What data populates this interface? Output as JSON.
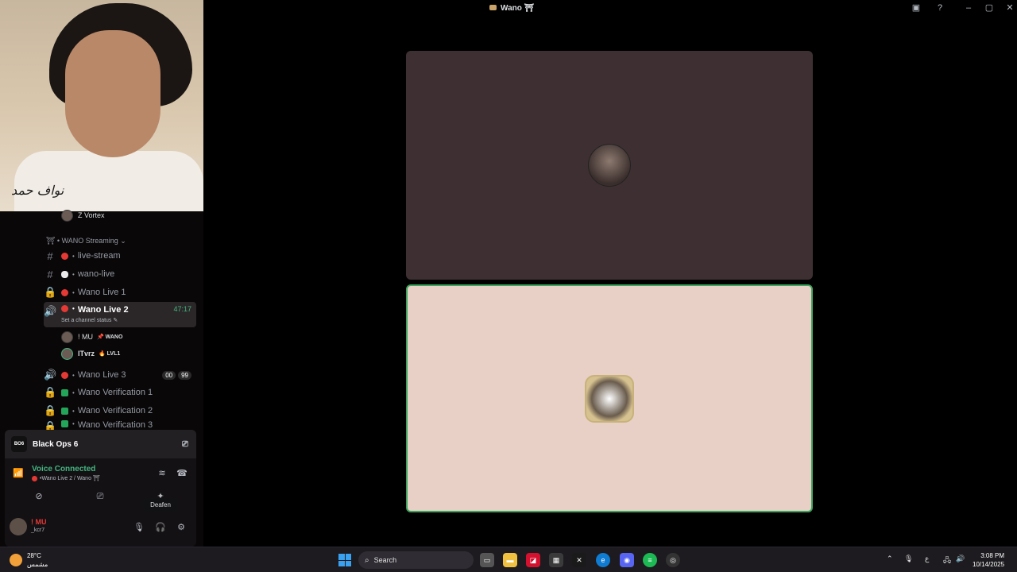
{
  "window": {
    "title": "Wano ⛩",
    "icons": {
      "inbox": "inbox-icon",
      "help": "help-icon",
      "minimize": "minimize-icon",
      "maximize": "maximize-icon",
      "close": "close-icon"
    }
  },
  "overlay": {
    "signature": "نواف حمد"
  },
  "sidebar": {
    "partial_member": "Z Vortex",
    "category": "WANO Streaming",
    "channels": [
      {
        "label": "live-stream",
        "type": "text"
      },
      {
        "label": "wano-live",
        "type": "text"
      },
      {
        "label": "Wano Live 1",
        "type": "locked-voice"
      },
      {
        "label": "Wano Live 2",
        "type": "voice-active",
        "timer": "47:17",
        "status_placeholder": "Set a channel status"
      },
      {
        "label": "Wano Live 3",
        "type": "voice",
        "count_a": "00",
        "count_b": "99"
      },
      {
        "label": "Wano Verification 1",
        "type": "locked-voice"
      },
      {
        "label": "Wano Verification 2",
        "type": "locked-voice"
      },
      {
        "label": "Wano Verification 3",
        "type": "locked-voice"
      }
    ],
    "members": [
      {
        "name": "! MU",
        "tag": "📌 WANO"
      },
      {
        "name": "lTvrz",
        "tag": "🔥 LVL1"
      }
    ]
  },
  "panel": {
    "game": "Black Ops 6",
    "game_logo": "BO6",
    "voice_status": "Voice Connected",
    "voice_channel": "Wano Live 2 / Wano ⛩",
    "tooltip": "Deafen",
    "username": "! MU",
    "usertag": "_kcr7"
  },
  "tiles": [
    {
      "avatar": "user-avatar-1"
    },
    {
      "avatar": "user-avatar-2",
      "speaking": true
    }
  ],
  "taskbar": {
    "weather_temp": "28°C",
    "weather_desc": "مشمس",
    "search": "Search",
    "lang": "ع",
    "time": "3:08 PM",
    "date": "10/14/2025"
  }
}
